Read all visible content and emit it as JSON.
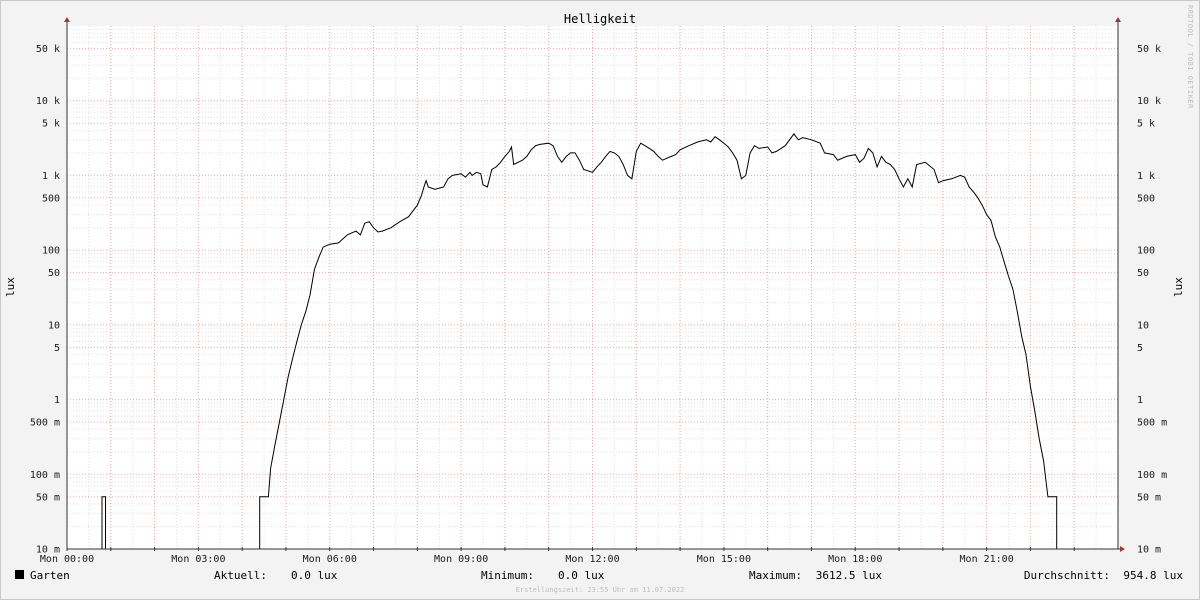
{
  "chart_data": {
    "type": "line",
    "title": "Helligkeit",
    "ylabel": "lux",
    "yscale": "log",
    "ylim": [
      0.01,
      100000
    ],
    "xlim": [
      0,
      24
    ],
    "y_ticks": [
      {
        "v": 0.01,
        "label": "10 m"
      },
      {
        "v": 0.05,
        "label": "50 m"
      },
      {
        "v": 0.1,
        "label": "100 m"
      },
      {
        "v": 0.5,
        "label": "500 m"
      },
      {
        "v": 1,
        "label": "1"
      },
      {
        "v": 5,
        "label": "5"
      },
      {
        "v": 10,
        "label": "10"
      },
      {
        "v": 50,
        "label": "50"
      },
      {
        "v": 100,
        "label": "100"
      },
      {
        "v": 500,
        "label": "500"
      },
      {
        "v": 1000,
        "label": "1 k"
      },
      {
        "v": 5000,
        "label": "5 k"
      },
      {
        "v": 10000,
        "label": "10 k"
      },
      {
        "v": 50000,
        "label": "50 k"
      }
    ],
    "x_ticks": [
      {
        "v": 0,
        "label": "Mon 00:00"
      },
      {
        "v": 3,
        "label": "Mon 03:00"
      },
      {
        "v": 6,
        "label": "Mon 06:00"
      },
      {
        "v": 9,
        "label": "Mon 09:00"
      },
      {
        "v": 12,
        "label": "Mon 12:00"
      },
      {
        "v": 15,
        "label": "Mon 15:00"
      },
      {
        "v": 18,
        "label": "Mon 18:00"
      },
      {
        "v": 21,
        "label": "Mon 21:00"
      }
    ],
    "series": [
      {
        "name": "Garten",
        "color": "#000000",
        "points": [
          [
            0,
            0.01
          ],
          [
            0.8,
            0.01
          ],
          [
            0.8,
            0.05
          ],
          [
            0.88,
            0.05
          ],
          [
            0.88,
            0.01
          ],
          [
            4.4,
            0.01
          ],
          [
            4.4,
            0.05
          ],
          [
            4.6,
            0.05
          ],
          [
            4.65,
            0.12
          ],
          [
            4.75,
            0.25
          ],
          [
            4.85,
            0.5
          ],
          [
            4.95,
            1
          ],
          [
            5.05,
            2
          ],
          [
            5.15,
            3.5
          ],
          [
            5.25,
            6
          ],
          [
            5.35,
            10
          ],
          [
            5.45,
            15
          ],
          [
            5.55,
            25
          ],
          [
            5.65,
            55
          ],
          [
            5.75,
            80
          ],
          [
            5.85,
            110
          ],
          [
            6.0,
            120
          ],
          [
            6.2,
            125
          ],
          [
            6.4,
            160
          ],
          [
            6.5,
            170
          ],
          [
            6.6,
            180
          ],
          [
            6.7,
            160
          ],
          [
            6.8,
            230
          ],
          [
            6.9,
            240
          ],
          [
            7.0,
            200
          ],
          [
            7.1,
            175
          ],
          [
            7.2,
            180
          ],
          [
            7.4,
            200
          ],
          [
            7.6,
            240
          ],
          [
            7.8,
            280
          ],
          [
            8.0,
            400
          ],
          [
            8.1,
            550
          ],
          [
            8.15,
            700
          ],
          [
            8.2,
            850
          ],
          [
            8.25,
            700
          ],
          [
            8.4,
            650
          ],
          [
            8.6,
            700
          ],
          [
            8.7,
            900
          ],
          [
            8.8,
            1000
          ],
          [
            9.0,
            1050
          ],
          [
            9.1,
            950
          ],
          [
            9.2,
            1100
          ],
          [
            9.25,
            1000
          ],
          [
            9.35,
            1100
          ],
          [
            9.45,
            1050
          ],
          [
            9.5,
            750
          ],
          [
            9.6,
            700
          ],
          [
            9.7,
            1200
          ],
          [
            9.8,
            1300
          ],
          [
            9.9,
            1500
          ],
          [
            10.0,
            1800
          ],
          [
            10.1,
            2100
          ],
          [
            10.15,
            2400
          ],
          [
            10.2,
            1400
          ],
          [
            10.4,
            1600
          ],
          [
            10.5,
            1800
          ],
          [
            10.6,
            2200
          ],
          [
            10.7,
            2500
          ],
          [
            10.8,
            2600
          ],
          [
            11.0,
            2700
          ],
          [
            11.1,
            2500
          ],
          [
            11.2,
            1800
          ],
          [
            11.3,
            1500
          ],
          [
            11.4,
            1800
          ],
          [
            11.5,
            2000
          ],
          [
            11.6,
            2000
          ],
          [
            11.7,
            1600
          ],
          [
            11.8,
            1200
          ],
          [
            12.0,
            1100
          ],
          [
            12.1,
            1300
          ],
          [
            12.2,
            1500
          ],
          [
            12.3,
            1800
          ],
          [
            12.4,
            2100
          ],
          [
            12.5,
            2000
          ],
          [
            12.6,
            1800
          ],
          [
            12.7,
            1400
          ],
          [
            12.8,
            1000
          ],
          [
            12.9,
            900
          ],
          [
            13.0,
            2100
          ],
          [
            13.1,
            2700
          ],
          [
            13.2,
            2500
          ],
          [
            13.3,
            2300
          ],
          [
            13.4,
            2100
          ],
          [
            13.5,
            1800
          ],
          [
            13.6,
            1600
          ],
          [
            13.7,
            1700
          ],
          [
            13.8,
            1800
          ],
          [
            13.9,
            1900
          ],
          [
            14.0,
            2200
          ],
          [
            14.2,
            2500
          ],
          [
            14.4,
            2800
          ],
          [
            14.6,
            3000
          ],
          [
            14.7,
            2800
          ],
          [
            14.8,
            3300
          ],
          [
            14.9,
            3000
          ],
          [
            15.0,
            2700
          ],
          [
            15.1,
            2400
          ],
          [
            15.2,
            2000
          ],
          [
            15.3,
            1600
          ],
          [
            15.4,
            900
          ],
          [
            15.5,
            1000
          ],
          [
            15.6,
            2000
          ],
          [
            15.7,
            2500
          ],
          [
            15.8,
            2300
          ],
          [
            16.0,
            2400
          ],
          [
            16.1,
            2000
          ],
          [
            16.2,
            2100
          ],
          [
            16.4,
            2500
          ],
          [
            16.6,
            3600
          ],
          [
            16.7,
            3000
          ],
          [
            16.8,
            3200
          ],
          [
            17.0,
            3000
          ],
          [
            17.2,
            2700
          ],
          [
            17.3,
            2000
          ],
          [
            17.5,
            1900
          ],
          [
            17.6,
            1600
          ],
          [
            17.8,
            1800
          ],
          [
            18.0,
            1900
          ],
          [
            18.1,
            1500
          ],
          [
            18.2,
            1700
          ],
          [
            18.3,
            2300
          ],
          [
            18.4,
            2000
          ],
          [
            18.5,
            1300
          ],
          [
            18.6,
            1800
          ],
          [
            18.7,
            1500
          ],
          [
            18.8,
            1400
          ],
          [
            18.9,
            1200
          ],
          [
            19.0,
            900
          ],
          [
            19.1,
            700
          ],
          [
            19.2,
            900
          ],
          [
            19.3,
            700
          ],
          [
            19.4,
            1400
          ],
          [
            19.6,
            1500
          ],
          [
            19.8,
            1200
          ],
          [
            19.9,
            800
          ],
          [
            20.0,
            850
          ],
          [
            20.2,
            900
          ],
          [
            20.4,
            1000
          ],
          [
            20.5,
            950
          ],
          [
            20.6,
            700
          ],
          [
            20.7,
            600
          ],
          [
            20.8,
            500
          ],
          [
            20.9,
            400
          ],
          [
            21.0,
            300
          ],
          [
            21.1,
            250
          ],
          [
            21.2,
            150
          ],
          [
            21.3,
            110
          ],
          [
            21.4,
            70
          ],
          [
            21.5,
            45
          ],
          [
            21.6,
            30
          ],
          [
            21.7,
            15
          ],
          [
            21.8,
            7
          ],
          [
            21.9,
            4
          ],
          [
            22.0,
            1.5
          ],
          [
            22.1,
            0.7
          ],
          [
            22.2,
            0.3
          ],
          [
            22.3,
            0.15
          ],
          [
            22.4,
            0.05
          ],
          [
            22.6,
            0.05
          ],
          [
            22.6,
            0.01
          ],
          [
            24,
            0.01
          ]
        ]
      }
    ],
    "legend": {
      "entries": [
        {
          "label": "Garten",
          "color": "#000000"
        }
      ],
      "stats": [
        {
          "label": "Aktuell:",
          "value": "0.0 lux"
        },
        {
          "label": "Minimum:",
          "value": "0.0 lux"
        },
        {
          "label": "Maximum:",
          "value": "3612.5 lux"
        },
        {
          "label": "Durchschnitt:",
          "value": "954.8 lux"
        }
      ]
    },
    "watermark": "RRDTOOL / TOBI OETIKER",
    "footer": "Erstellungszeit: 23:55 Uhr am 11.07.2022"
  }
}
